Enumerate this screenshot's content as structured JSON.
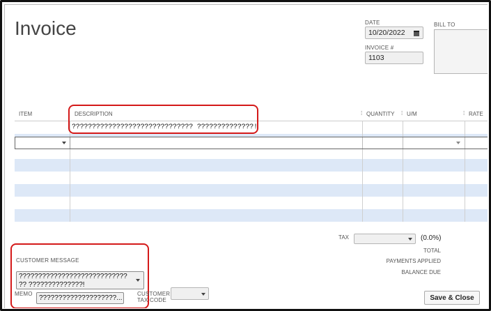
{
  "title": "Invoice",
  "date": {
    "label": "DATE",
    "value": "10/20/2022"
  },
  "invoice_no": {
    "label": "INVOICE #",
    "value": "1103"
  },
  "bill_to": {
    "label": "BILL TO"
  },
  "columns": [
    {
      "label": "ITEM"
    },
    {
      "label": "DESCRIPTION"
    },
    {
      "label": "QUANTITY"
    },
    {
      "label": "U/M"
    },
    {
      "label": "RATE"
    }
  ],
  "line_items": [
    {
      "description": "?????????????????????????????? ??????????????!"
    }
  ],
  "tax": {
    "label": "TAX",
    "value": "",
    "percent": "(0.0%)"
  },
  "totals": {
    "total": "TOTAL",
    "payments_applied": "PAYMENTS APPLIED",
    "balance_due": "BALANCE DUE"
  },
  "customer_message": {
    "label": "CUSTOMER MESSAGE",
    "value": "???????????????????????????? ?? ??????????????!"
  },
  "memo": {
    "label": "MEMO",
    "value": "????????????????????..."
  },
  "customer_tax_code": {
    "label_line1": "CUSTOMER",
    "label_line2": "TAX CODE",
    "value": ""
  },
  "save_close": {
    "label": "Save & Close"
  }
}
